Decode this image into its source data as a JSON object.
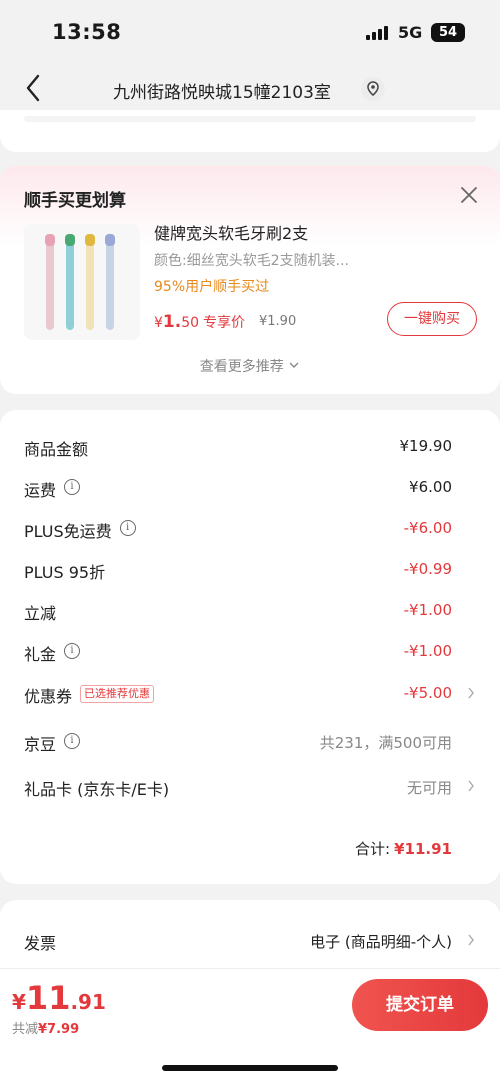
{
  "status": {
    "time": "13:58",
    "network": "5G",
    "battery": "54"
  },
  "nav": {
    "address": "九州街路悦映城15幢2103室"
  },
  "recommend": {
    "title": "顺手买更划算",
    "product": {
      "name": "健牌宽头软毛牙刷2支",
      "spec": "颜色:细丝宽头软毛2支随机装...",
      "percent_text": "95%用户顺手买过",
      "price_symbol": "¥",
      "price_int": "1.",
      "price_dec": "50",
      "price_tag": "专享价",
      "original_price": "¥1.90",
      "buy_label": "一键购买"
    },
    "more_label": "查看更多推荐",
    "brush_colors": [
      "#e9c8cf",
      "#8fd0d8",
      "#f2e3b6",
      "#c9d3e6"
    ],
    "brush_head_colors": [
      "#e8a2b4",
      "#4aa872",
      "#e0b840",
      "#9aa8d8"
    ]
  },
  "summary": {
    "rows": [
      {
        "label": "商品金额",
        "value": "¥19.90",
        "style": "normal"
      },
      {
        "label": "运费",
        "value": "¥6.00",
        "style": "normal",
        "info": true
      },
      {
        "label": "PLUS免运费",
        "value": "-¥6.00",
        "style": "red",
        "info": true
      },
      {
        "label": "PLUS 95折",
        "value": "-¥0.99",
        "style": "red"
      },
      {
        "label": "立减",
        "value": "-¥1.00",
        "style": "red"
      },
      {
        "label": "礼金",
        "value": "-¥1.00",
        "style": "red",
        "info": true
      },
      {
        "label": "优惠券",
        "value": "-¥5.00",
        "style": "red",
        "badge": "已选推荐优惠",
        "arrow": true
      },
      {
        "label": "京豆",
        "value": "共231，满500可用",
        "style": "gray",
        "info": true
      },
      {
        "label": "礼品卡 (京东卡/E卡)",
        "value": "无可用",
        "style": "gray",
        "arrow": true
      }
    ],
    "total_label": "合计:",
    "total_value": "¥11.91"
  },
  "invoice": {
    "label": "发票",
    "value": "电子 (商品明细-个人)"
  },
  "bottom": {
    "currency": "¥",
    "total_int": "11",
    "total_dec": ".91",
    "saved_label": "共减",
    "saved_value": "¥7.99",
    "submit_label": "提交订单"
  },
  "colors": {
    "accent": "#e4393c",
    "orange": "#e8891c"
  }
}
